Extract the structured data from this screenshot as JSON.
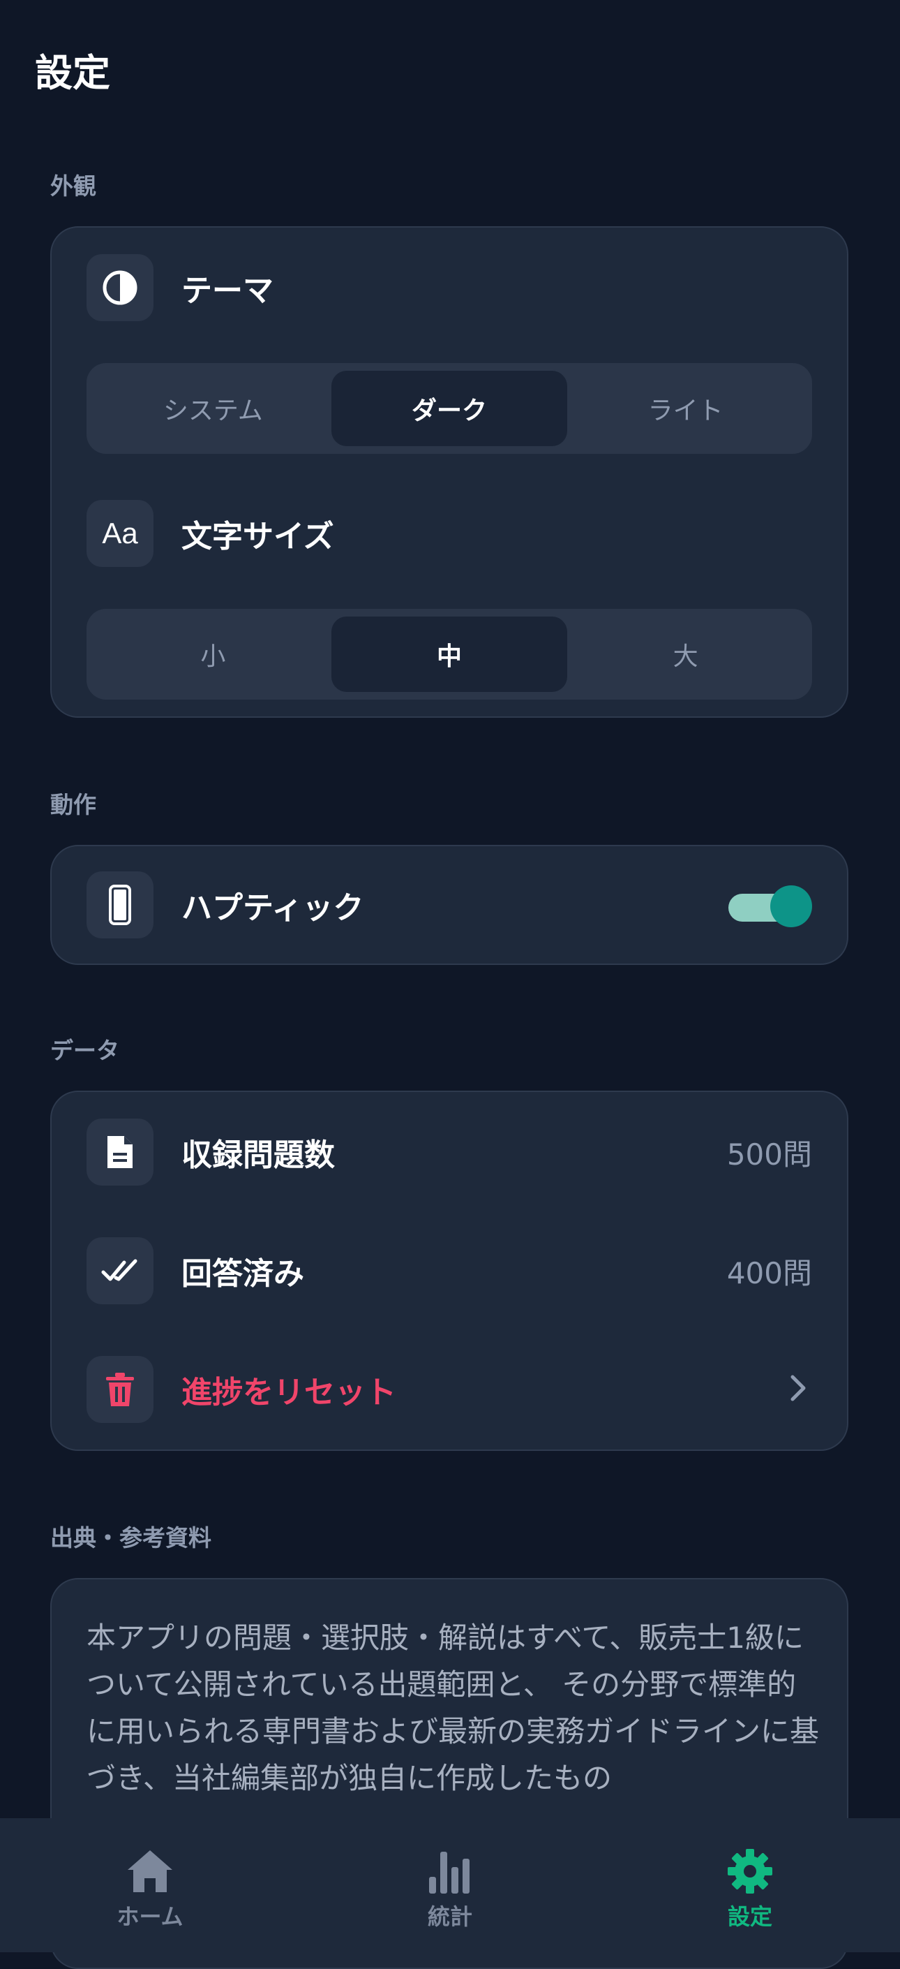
{
  "header": {
    "title": "設定"
  },
  "appearance": {
    "section_label": "外観",
    "theme": {
      "label": "テーマ",
      "options": [
        "システム",
        "ダーク",
        "ライト"
      ],
      "selected": "ダーク"
    },
    "font_size": {
      "label": "文字サイズ",
      "options": [
        "小",
        "中",
        "大"
      ],
      "selected": "中"
    }
  },
  "behavior": {
    "section_label": "動作",
    "haptic": {
      "label": "ハプティック",
      "enabled": true
    }
  },
  "data_section": {
    "section_label": "データ",
    "total_questions": {
      "label": "収録問題数",
      "value": "500問"
    },
    "answered": {
      "label": "回答済み",
      "value": "400問"
    },
    "reset": {
      "label": "進捗をリセット"
    }
  },
  "sources": {
    "section_label": "出典・参考資料",
    "text": "本アプリの問題・選択肢・解説はすべて、販売士1級について公開されている出題範囲と、 その分野で標準的に用いられる専門書および最新の実務ガイドラインに基づき、当社編集部が独自に作成したもの"
  },
  "tabbar": {
    "tabs": [
      {
        "label": "ホーム",
        "icon": "home-icon"
      },
      {
        "label": "統計",
        "icon": "bar-chart-icon"
      },
      {
        "label": "設定",
        "icon": "gear-icon"
      }
    ],
    "active": "設定"
  },
  "colors": {
    "background": "#0f1727",
    "card": "#1e293b",
    "accent": "#10b981",
    "toggle": "#0d9488",
    "danger": "#f0456a"
  }
}
